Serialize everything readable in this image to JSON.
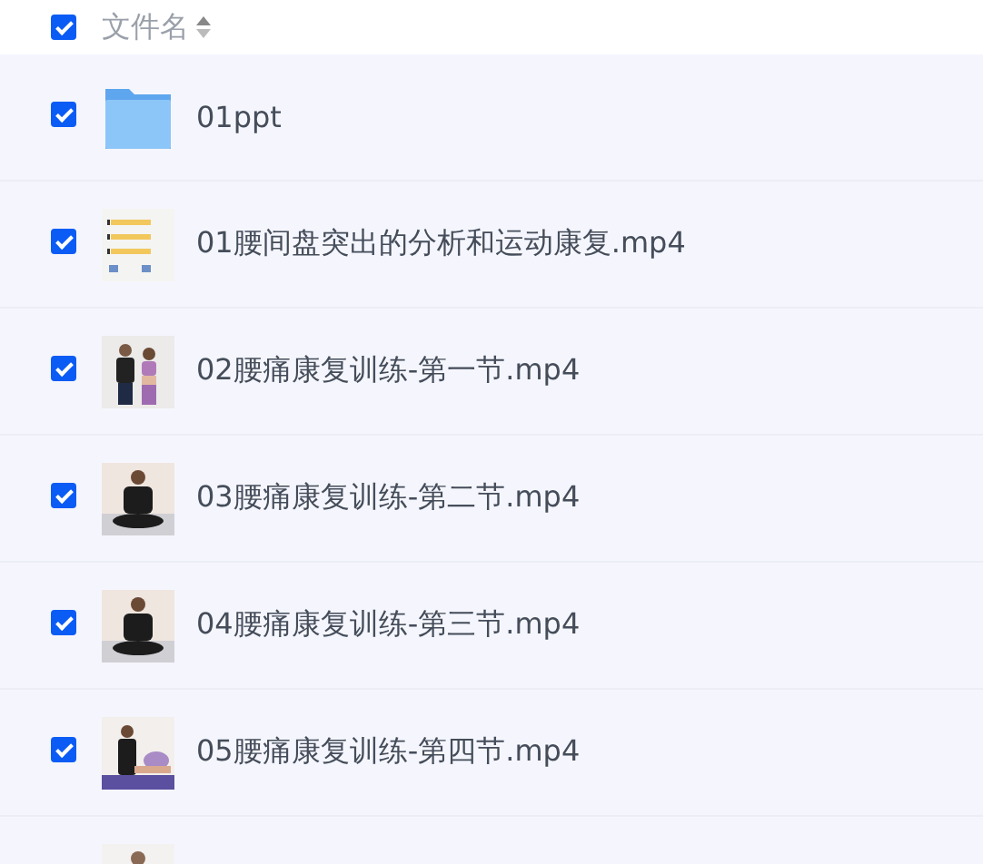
{
  "header": {
    "checked": true,
    "label": "文件名"
  },
  "rows": [
    {
      "kind": "folder",
      "checked": true,
      "name": "01ppt"
    },
    {
      "kind": "document",
      "checked": true,
      "name": "01腰间盘突出的分析和运动康复.mp4"
    },
    {
      "kind": "duo",
      "checked": true,
      "name": "02腰痛康复训练-第一节.mp4"
    },
    {
      "kind": "seated",
      "checked": true,
      "name": "03腰痛康复训练-第二节.mp4"
    },
    {
      "kind": "seated",
      "checked": true,
      "name": "04腰痛康复训练-第三节.mp4"
    },
    {
      "kind": "stretch",
      "checked": true,
      "name": "05腰痛康复训练-第四节.mp4"
    },
    {
      "kind": "standing"
    }
  ]
}
